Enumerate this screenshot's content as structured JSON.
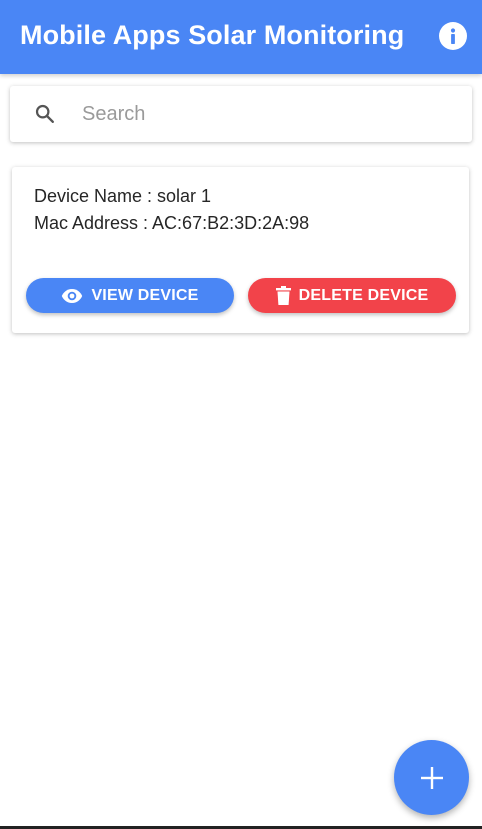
{
  "app_bar": {
    "title": "Mobile Apps Solar Monitoring",
    "info_icon": "info-circle-icon",
    "background_color": "#4a86f5"
  },
  "search": {
    "placeholder": "Search",
    "value": "",
    "icon": "search-icon"
  },
  "devices": [
    {
      "name_line": "Device Name : solar 1",
      "mac_line": "Mac Address : AC:67:B2:3D:2A:98",
      "view_label": "VIEW DEVICE",
      "view_icon": "eye-icon",
      "delete_label": "DELETE DEVICE",
      "delete_icon": "trash-icon"
    }
  ],
  "fab": {
    "icon": "plus-icon",
    "color": "#4a86f5"
  },
  "colors": {
    "primary": "#4a86f5",
    "danger": "#f2434a"
  }
}
